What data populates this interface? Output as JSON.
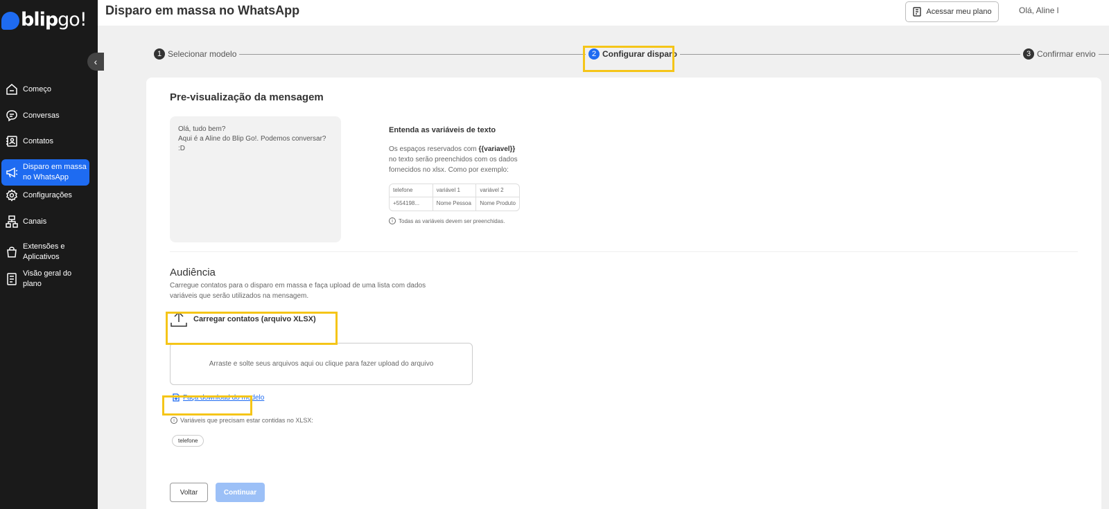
{
  "sidebar": {
    "logo_main": "blip",
    "logo_accent": "go!",
    "collapse_icon": "chevron-left-icon",
    "items": [
      {
        "label": "Começo",
        "icon": "home-icon"
      },
      {
        "label": "Conversas",
        "icon": "chat-icon"
      },
      {
        "label": "Contatos",
        "icon": "contacts-icon"
      },
      {
        "label": "Disparo em massa no WhatsApp",
        "icon": "megaphone-icon",
        "active": true
      },
      {
        "label": "Configurações",
        "icon": "gear-icon"
      },
      {
        "label": "Canais",
        "icon": "channels-icon"
      },
      {
        "label": "Extensões e Aplicativos",
        "icon": "bag-icon"
      },
      {
        "label": "Visão geral do plano",
        "icon": "plan-icon"
      }
    ]
  },
  "header": {
    "title": "Disparo em massa no WhatsApp",
    "plan_button": "Acessar meu plano",
    "greeting": "Olá, Aline l"
  },
  "stepper": {
    "steps": [
      {
        "num": "1",
        "label": "Selecionar modelo"
      },
      {
        "num": "2",
        "label": "Configurar disparo",
        "active": true
      },
      {
        "num": "3",
        "label": "Confirmar envio"
      }
    ]
  },
  "preview": {
    "title": "Pre-visualização da mensagem",
    "line1": "Olá, tudo bem?",
    "line2": "Aqui é a Aline do Blip Go!. Podemos conversar? :D"
  },
  "variables": {
    "title": "Entenda as variáveis de texto",
    "desc_before": "Os espaços reservados com ",
    "desc_token": "{{variavel}}",
    "desc_after": " no texto serão preenchidos com os dados fornecidos no xlsx. Como por exemplo:",
    "table": {
      "headers": [
        "telefone",
        "variável 1",
        "variável 2"
      ],
      "row": [
        "+554198...",
        "Nome Pessoa",
        "Nome Produto"
      ]
    },
    "note": "Todas as variáveis devem ser preenchidas."
  },
  "audience": {
    "title": "Audiência",
    "desc": "Carregue contatos para o disparo em massa e faça upload de uma lista com dados variáveis que serão utilizados na mensagem.",
    "upload_label": "Carregar contatos (arquivo XLSX)",
    "dropzone_text": "Arraste e solte seus arquivos aqui ou clique para fazer upload do arquivo",
    "download_link": "Faça download do modelo",
    "required_label": "Variáveis que precisam estar contidas no XLSX:",
    "chips": [
      "telefone"
    ]
  },
  "actions": {
    "back": "Voltar",
    "continue": "Continuar"
  },
  "colors": {
    "accent": "#1e6bf1",
    "highlight": "#f5c518",
    "sidebar_bg": "#1a1a1a"
  }
}
